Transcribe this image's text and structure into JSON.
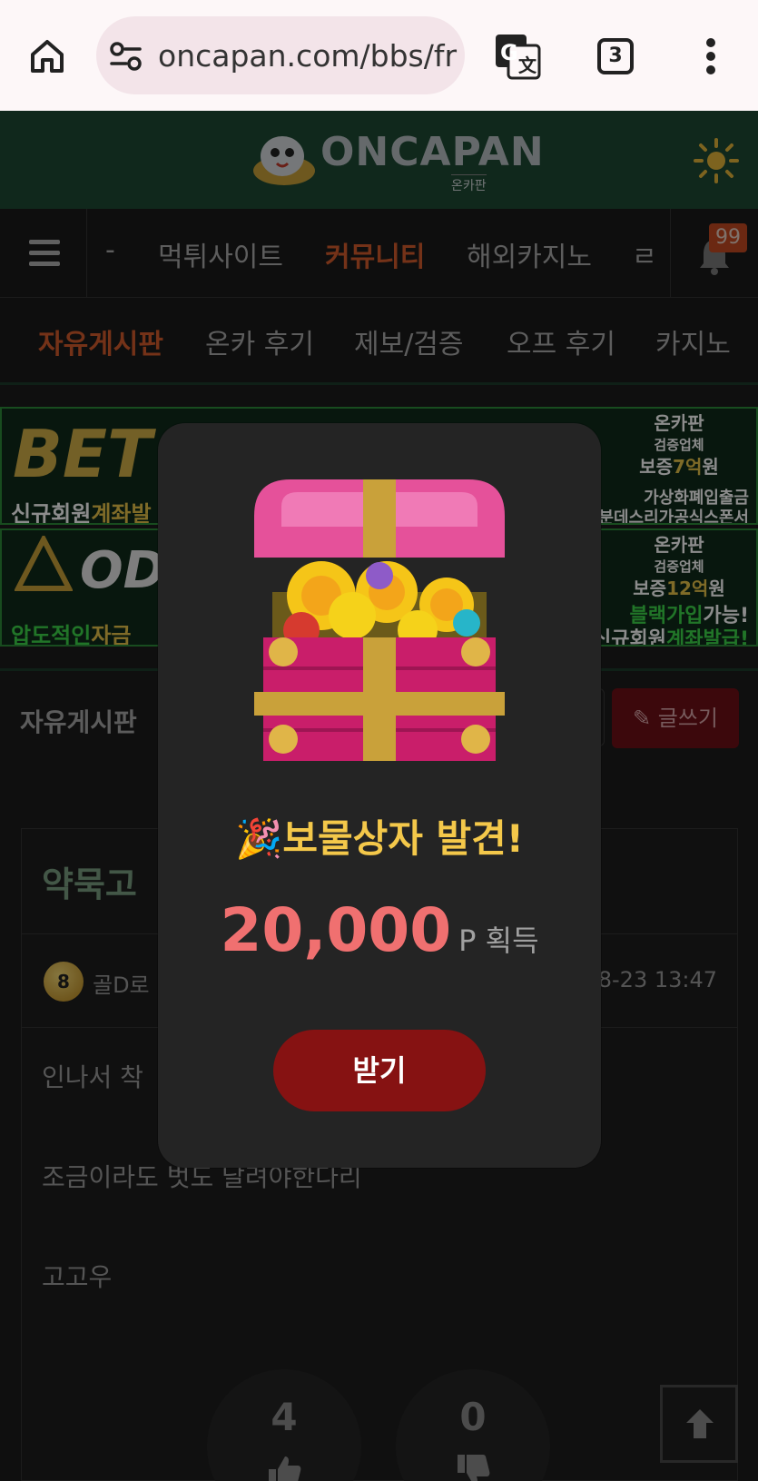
{
  "browser": {
    "url": "oncapan.com/bbs/fr",
    "tab_count": "3"
  },
  "site": {
    "logo_text": "ONCAPAN",
    "logo_sub": "온카판"
  },
  "main_nav": {
    "items": [
      {
        "label": "-"
      },
      {
        "label": "먹튀사이트"
      },
      {
        "label": "커뮤니티",
        "active": true
      },
      {
        "label": "해외카지노"
      },
      {
        "label": "ㄹ"
      }
    ],
    "notification_count": "99"
  },
  "sub_nav": {
    "items": [
      {
        "label": "자유게시판",
        "active": true
      },
      {
        "label": "온카 후기"
      },
      {
        "label": "제보/검증"
      },
      {
        "label": "오프 후기"
      },
      {
        "label": "카지노"
      }
    ]
  },
  "banners": [
    {
      "big": "BET",
      "line_white": "신규회원",
      "line_gold": "계좌발",
      "right_line1": "가상화폐입출금",
      "right_line2": "분데스리가공식스폰서",
      "badge_l1": "온카판",
      "badge_l2": "검증업체",
      "badge_l3a": "보증",
      "badge_l3b": "7억",
      "badge_l3c": "원"
    },
    {
      "big": "ODI",
      "line_green": "압도적인",
      "line_gold": "자금",
      "right_line1": "블랙가입",
      "right_line1b": "가능!",
      "right_line2a": "신규회원",
      "right_line2b": "계좌발급!",
      "badge_l1": "온카판",
      "badge_l2": "검증업체",
      "badge_l3a": "보증",
      "badge_l3b": "12억",
      "badge_l3c": "원"
    }
  ],
  "board": {
    "title": "자유게시판",
    "write_label": "글쓰기"
  },
  "post": {
    "title": "약묵고 ",
    "level": "8",
    "author": "골D로",
    "date": "08-23 13:47",
    "lines": [
      "인나서 착",
      "조금이라도 벗도 달려야한다리",
      "고고우"
    ],
    "likes": "4",
    "dislikes": "0"
  },
  "modal": {
    "party_emoji": "🎉",
    "title": "보물상자 발견!",
    "amount": "20,000",
    "unit": "P 획득",
    "claim_label": "받기"
  },
  "colors": {
    "header_green": "#1e4a33",
    "active_orange": "#d35c2d",
    "gold": "#f4c84a",
    "reward_red": "#f07070",
    "claim_red": "#861212"
  }
}
